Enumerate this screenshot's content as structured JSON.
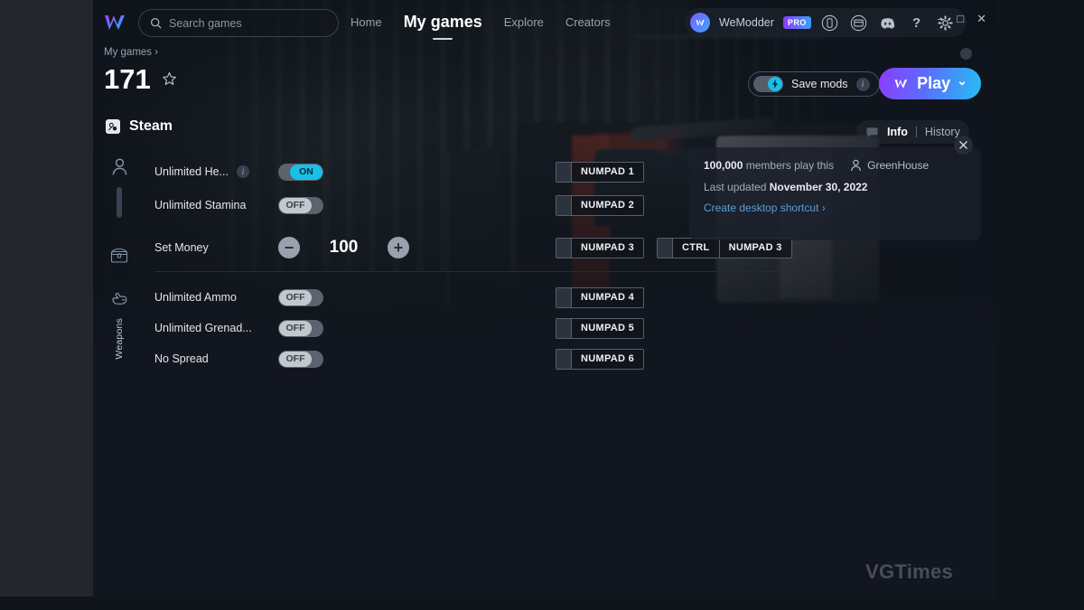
{
  "window": {
    "controls": {
      "minimize": "–",
      "maximize": "□",
      "close": "✕"
    }
  },
  "topbar": {
    "logo_icon": "wemod-logo-icon",
    "search": {
      "placeholder": "Search games",
      "value": "",
      "icon": "search-icon"
    },
    "nav": [
      {
        "label": "Home",
        "active": false
      },
      {
        "label": "My games",
        "active": true
      },
      {
        "label": "Explore",
        "active": false
      },
      {
        "label": "Creators",
        "active": false
      }
    ],
    "account": {
      "name": "WeModder",
      "badge": "PRO",
      "avatar_icon": "wemod-avatar-icon"
    },
    "actions": [
      {
        "icon": "phone-panel-icon"
      },
      {
        "icon": "window-panel-icon"
      },
      {
        "icon": "discord-icon"
      },
      {
        "icon": "help-icon",
        "glyph": "?"
      },
      {
        "icon": "gear-icon"
      }
    ]
  },
  "header": {
    "breadcrumb": "My games",
    "breadcrumb_chevron": "›",
    "title": "171",
    "favorite_icon": "star-icon",
    "platform": {
      "name": "Steam",
      "icon": "steam-icon"
    },
    "save_mods": {
      "label": "Save mods",
      "state": "on",
      "info": "i",
      "bolt_icon": "bolt-icon"
    },
    "play": {
      "label": "Play",
      "icon": "wemod-play-icon",
      "chevron": "⌄"
    }
  },
  "info_tabs": {
    "chat_icon": "chat-bubble-icon",
    "tabs": [
      {
        "label": "Info",
        "active": true
      },
      {
        "label": "History",
        "active": false
      }
    ]
  },
  "info_panel": {
    "members_count": "100,000",
    "members_text": "members play this",
    "author": "GreenHouse",
    "author_icon": "person-icon",
    "updated_label": "Last updated",
    "updated_date": "November 30, 2022",
    "shortcut_link": "Create desktop shortcut",
    "shortcut_chevron": "›",
    "close_icon": "close-icon"
  },
  "groups": [
    {
      "icon": "person-icon",
      "vertical_label": "",
      "rows": [
        {
          "label": "Unlimited He...",
          "has_info": true,
          "control": "toggle",
          "state": "ON",
          "hotkeys": [
            {
              "keys": [
                "NUMPAD 1"
              ]
            }
          ]
        },
        {
          "label": "Unlimited Stamina",
          "has_info": false,
          "control": "toggle",
          "state": "OFF",
          "hotkeys": [
            {
              "keys": [
                "NUMPAD 2"
              ]
            }
          ]
        }
      ]
    },
    {
      "icon": "chest-icon",
      "vertical_label": "",
      "rows": [
        {
          "label": "Set Money",
          "has_info": false,
          "control": "stepper",
          "value": "100",
          "minus": "−",
          "plus": "+",
          "hotkeys": [
            {
              "keys": [
                "NUMPAD 3"
              ]
            },
            {
              "keys": [
                "CTRL",
                "NUMPAD 3"
              ]
            }
          ]
        }
      ]
    },
    {
      "icon": "hand-pointer-icon",
      "vertical_label": "Weapons",
      "rows": [
        {
          "label": "Unlimited Ammo",
          "has_info": false,
          "control": "toggle",
          "state": "OFF",
          "hotkeys": [
            {
              "keys": [
                "NUMPAD 4"
              ]
            }
          ]
        },
        {
          "label": "Unlimited Grenad...",
          "has_info": false,
          "control": "toggle",
          "state": "OFF",
          "hotkeys": [
            {
              "keys": [
                "NUMPAD 5"
              ]
            }
          ]
        },
        {
          "label": "No Spread",
          "has_info": false,
          "control": "toggle",
          "state": "OFF",
          "hotkeys": [
            {
              "keys": [
                "NUMPAD 6"
              ]
            }
          ]
        }
      ]
    }
  ],
  "watermark": "VGTimes",
  "colors": {
    "accent_cyan": "#18c0e8",
    "accent_purple": "#8b3dff",
    "link_blue": "#5b9fd6",
    "panel_bg": "#1a1f29",
    "app_bg": "#121620"
  }
}
